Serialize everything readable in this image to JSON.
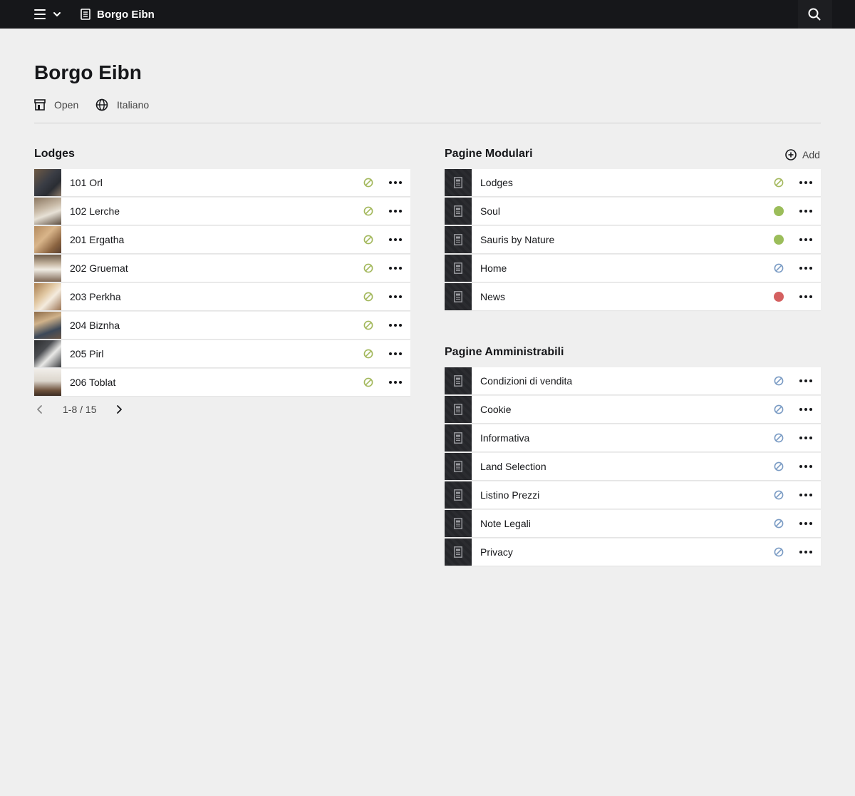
{
  "app": {
    "title": "Borgo Eibn",
    "status": "Open",
    "language": "Italiano"
  },
  "lodges": {
    "title": "Lodges",
    "items": [
      {
        "label": "101 Orl",
        "status": "unpublished-icon"
      },
      {
        "label": "102 Lerche",
        "status": "unpublished-icon"
      },
      {
        "label": "201 Ergatha",
        "status": "unpublished-icon"
      },
      {
        "label": "202 Gruemat",
        "status": "unpublished-icon"
      },
      {
        "label": "203 Perkha",
        "status": "unpublished-icon"
      },
      {
        "label": "204 Biznha",
        "status": "unpublished-icon"
      },
      {
        "label": "205 Pirl",
        "status": "unpublished-icon"
      },
      {
        "label": "206 Toblat",
        "status": "unpublished-icon"
      }
    ],
    "pagination": "1-8 / 15"
  },
  "modular": {
    "title": "Pagine Modulari",
    "add_label": "Add",
    "items": [
      {
        "label": "Lodges",
        "status": "unpublished",
        "color": "#a3b85c"
      },
      {
        "label": "Soul",
        "status": "published",
        "color": "#9bbd5a"
      },
      {
        "label": "Sauris by Nature",
        "status": "published",
        "color": "#9bbd5a"
      },
      {
        "label": "Home",
        "status": "unpublished",
        "color": "#7a9bc4"
      },
      {
        "label": "News",
        "status": "error",
        "color": "#d46060"
      }
    ]
  },
  "admin": {
    "title": "Pagine Amministrabili",
    "items": [
      {
        "label": "Condizioni di vendita",
        "status": "unpublished",
        "color": "#7a9bc4"
      },
      {
        "label": "Cookie",
        "status": "unpublished",
        "color": "#7a9bc4"
      },
      {
        "label": "Informativa",
        "status": "unpublished",
        "color": "#7a9bc4"
      },
      {
        "label": "Land Selection",
        "status": "unpublished",
        "color": "#7a9bc4"
      },
      {
        "label": "Listino Prezzi",
        "status": "unpublished",
        "color": "#7a9bc4"
      },
      {
        "label": "Note Legali",
        "status": "unpublished",
        "color": "#7a9bc4"
      },
      {
        "label": "Privacy",
        "status": "unpublished",
        "color": "#7a9bc4"
      }
    ]
  },
  "colors": {
    "topbar": "#16171a",
    "background": "#efefef",
    "lodge_status": "#a3b85c"
  }
}
